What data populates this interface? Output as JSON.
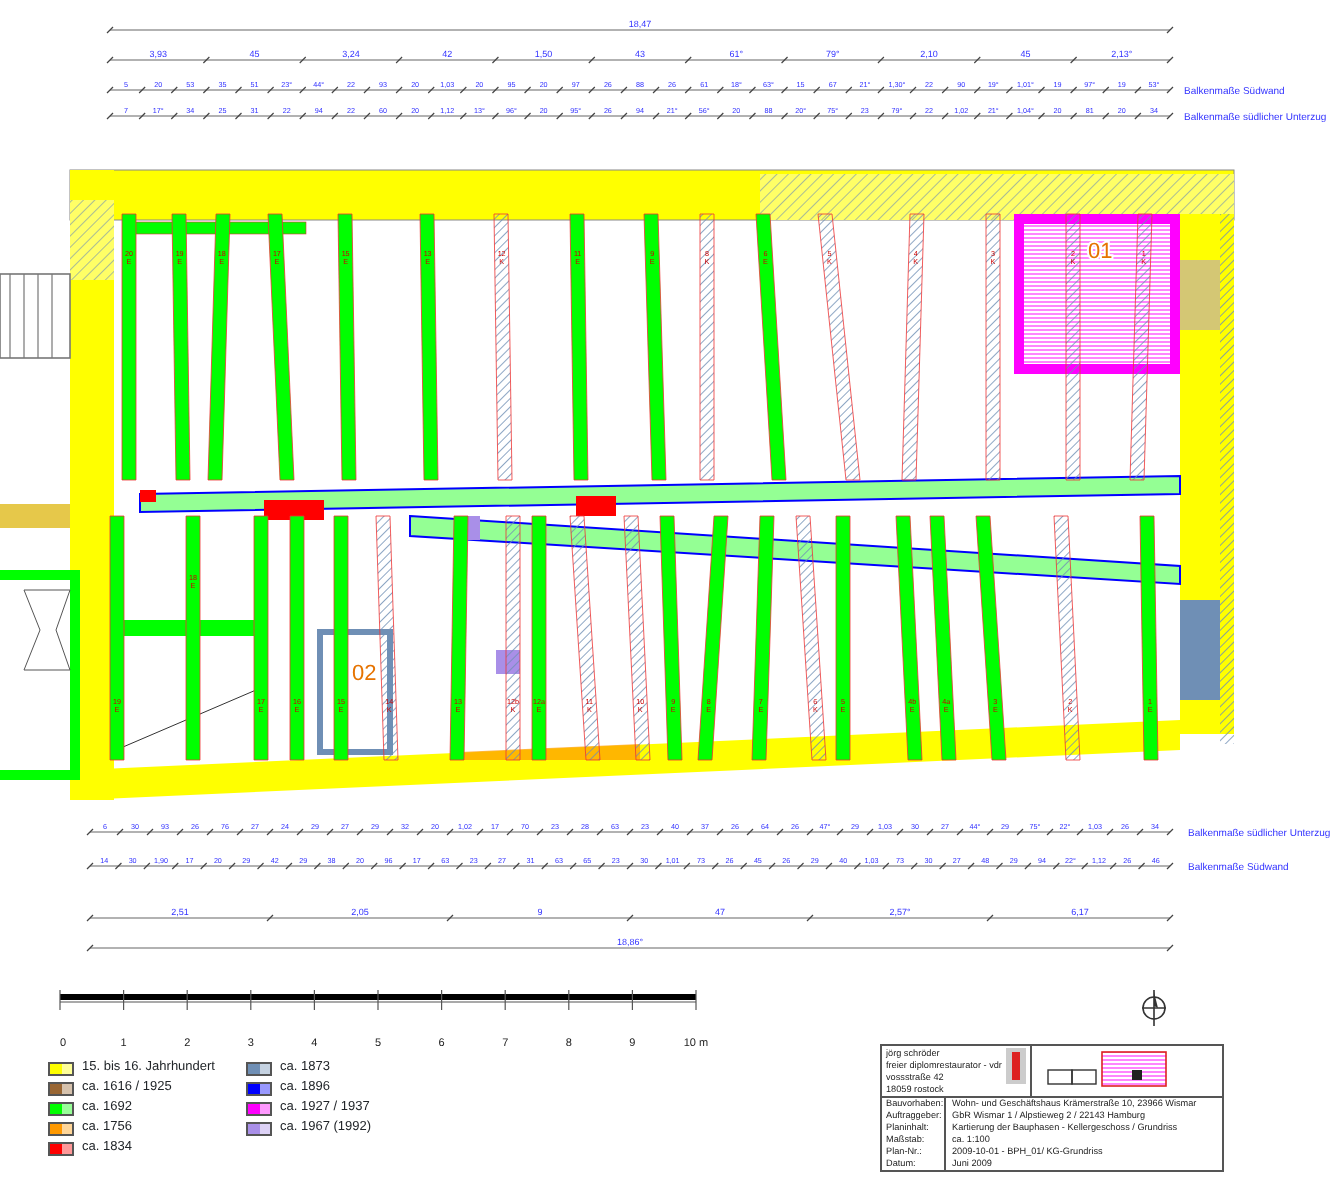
{
  "dimensions_top": [
    {
      "values": [
        "18,47"
      ]
    },
    {
      "values": [
        "3,93",
        "45",
        "3,24",
        "42",
        "1,50",
        "43",
        "61°",
        "79°",
        "2,10",
        "45",
        "2,13°"
      ]
    },
    {
      "label": "Balkenmaße Südwand",
      "values": [
        "5",
        "20",
        "53",
        "35",
        "51",
        "23°",
        "44°",
        "22",
        "93",
        "20",
        "1,03",
        "20",
        "95",
        "20",
        "97",
        "26",
        "88",
        "26",
        "61",
        "18°",
        "63°",
        "15",
        "67",
        "21°",
        "1,30°",
        "22",
        "90",
        "19°",
        "1,01°",
        "19",
        "97°",
        "19",
        "53°"
      ]
    },
    {
      "label": "Balkenmaße südlicher Unterzug",
      "values": [
        "7",
        "17°",
        "34",
        "25",
        "31",
        "22",
        "94",
        "22",
        "60",
        "20",
        "1,12",
        "13°",
        "96°",
        "20",
        "95°",
        "26",
        "94",
        "21°",
        "56°",
        "20",
        "88",
        "20°",
        "75°",
        "23",
        "79°",
        "22",
        "1,02",
        "21°",
        "1,04°",
        "20",
        "81",
        "20",
        "34"
      ]
    }
  ],
  "floor_plan": {
    "rooms": [
      "01",
      "02"
    ],
    "beams_north": [
      {
        "label": "20 E",
        "kind": "solid"
      },
      {
        "label": "19 E",
        "kind": "solid"
      },
      {
        "label": "18 E",
        "kind": "solid"
      },
      {
        "label": "17 E",
        "kind": "solid"
      },
      {
        "label": "15 E",
        "kind": "solid"
      },
      {
        "label": "13 E",
        "kind": "solid"
      },
      {
        "label": "12 K",
        "kind": "hatched"
      },
      {
        "label": "11 E",
        "kind": "solid"
      },
      {
        "label": "9 E",
        "kind": "solid"
      },
      {
        "label": "8 K",
        "kind": "hatched"
      },
      {
        "label": "6 E",
        "kind": "solid"
      },
      {
        "label": "5 K",
        "kind": "hatched"
      },
      {
        "label": "4 K",
        "kind": "hatched"
      },
      {
        "label": "3 K",
        "kind": "hatched"
      },
      {
        "label": "2 K",
        "kind": "hatched"
      },
      {
        "label": "1 K",
        "kind": "hatched"
      }
    ],
    "beams_south": [
      {
        "label": "19 E",
        "kind": "solid"
      },
      {
        "label": "18 E",
        "kind": "solid"
      },
      {
        "label": "17 E",
        "kind": "solid"
      },
      {
        "label": "16 E",
        "kind": "solid"
      },
      {
        "label": "15 E",
        "kind": "solid"
      },
      {
        "label": "14 K",
        "kind": "hatched"
      },
      {
        "label": "13 E",
        "kind": "solid"
      },
      {
        "label": "12b K",
        "kind": "hatched"
      },
      {
        "label": "12a E",
        "kind": "solid"
      },
      {
        "label": "11 K",
        "kind": "hatched"
      },
      {
        "label": "10 K",
        "kind": "hatched"
      },
      {
        "label": "9 E",
        "kind": "solid"
      },
      {
        "label": "8 E",
        "kind": "solid"
      },
      {
        "label": "7 E",
        "kind": "solid"
      },
      {
        "label": "6 K",
        "kind": "hatched"
      },
      {
        "label": "5 E",
        "kind": "solid"
      },
      {
        "label": "4b E",
        "kind": "solid"
      },
      {
        "label": "4a E",
        "kind": "solid"
      },
      {
        "label": "3 E",
        "kind": "solid"
      },
      {
        "label": "2 K",
        "kind": "hatched"
      },
      {
        "label": "1 E",
        "kind": "solid"
      }
    ]
  },
  "dimensions_bottom": [
    {
      "label": "Balkenmaße südlicher Unterzug",
      "values": [
        "6",
        "30",
        "93",
        "26",
        "76",
        "27",
        "24",
        "29",
        "27",
        "29",
        "32",
        "20",
        "1,02",
        "17",
        "70",
        "23",
        "28",
        "63",
        "23",
        "40",
        "37",
        "26",
        "64",
        "26",
        "47°",
        "29",
        "1,03",
        "30",
        "27",
        "44°",
        "29",
        "75°",
        "22°",
        "1,03",
        "26",
        "34"
      ]
    },
    {
      "label": "Balkenmaße Südwand",
      "values": [
        "14",
        "30",
        "1,90",
        "17",
        "20",
        "29",
        "42",
        "29",
        "38",
        "20",
        "96",
        "17",
        "63",
        "23",
        "27",
        "31",
        "63",
        "65",
        "23",
        "30",
        "1,01",
        "73",
        "26",
        "45",
        "26",
        "29",
        "40",
        "1,03",
        "73",
        "30",
        "27",
        "48",
        "29",
        "94",
        "22°",
        "1,12",
        "26",
        "46"
      ]
    },
    {
      "values": [
        "2,51",
        "2,05",
        "9",
        "47",
        "2,57°",
        "6,17"
      ]
    },
    {
      "values": [
        "18,86°"
      ]
    }
  ],
  "scale_bar": {
    "ticks": [
      "0",
      "1",
      "2",
      "3",
      "4",
      "5",
      "6",
      "7",
      "8",
      "9",
      "10 m"
    ]
  },
  "legend": [
    {
      "label": "15. bis 16. Jahrhundert",
      "color": "#ffff00"
    },
    {
      "label": "ca. 1616 / 1925",
      "color": "#996633"
    },
    {
      "label": "ca. 1692",
      "color": "#00ff00"
    },
    {
      "label": "ca. 1756",
      "color": "#ff9900"
    },
    {
      "label": "ca. 1834",
      "color": "#ff0000"
    },
    {
      "label": "ca. 1873",
      "color": "#6f8fb5"
    },
    {
      "label": "ca. 1896",
      "color": "#0000ff"
    },
    {
      "label": "ca. 1927 / 1937",
      "color": "#ff00ff"
    },
    {
      "label": "ca. 1967 (1992)",
      "color": "#a98fe8"
    }
  ],
  "title_block": {
    "author": [
      "jörg schröder",
      "freier diplomrestaurator - vdr",
      "vossstraße 42",
      "18059 rostock"
    ],
    "fields": [
      {
        "label": "Bauvorhaben:",
        "value": "Wohn- und Geschäftshaus Krämerstraße 10, 23966 Wismar"
      },
      {
        "label": "Auftraggeber:",
        "value": "GbR Wismar 1 / Alpstieweg 2 / 22143 Hamburg"
      },
      {
        "label": "Planinhalt:",
        "value": "Kartierung der Bauphasen - Kellergeschoss / Grundriss"
      },
      {
        "label": "Maßstab:",
        "value": "ca. 1:100"
      },
      {
        "label": "Plan-Nr.:",
        "value": "2009-10-01 - BPH_01/ KG-Grundriss"
      },
      {
        "label": "Datum:",
        "value": "Juni 2009"
      }
    ]
  }
}
